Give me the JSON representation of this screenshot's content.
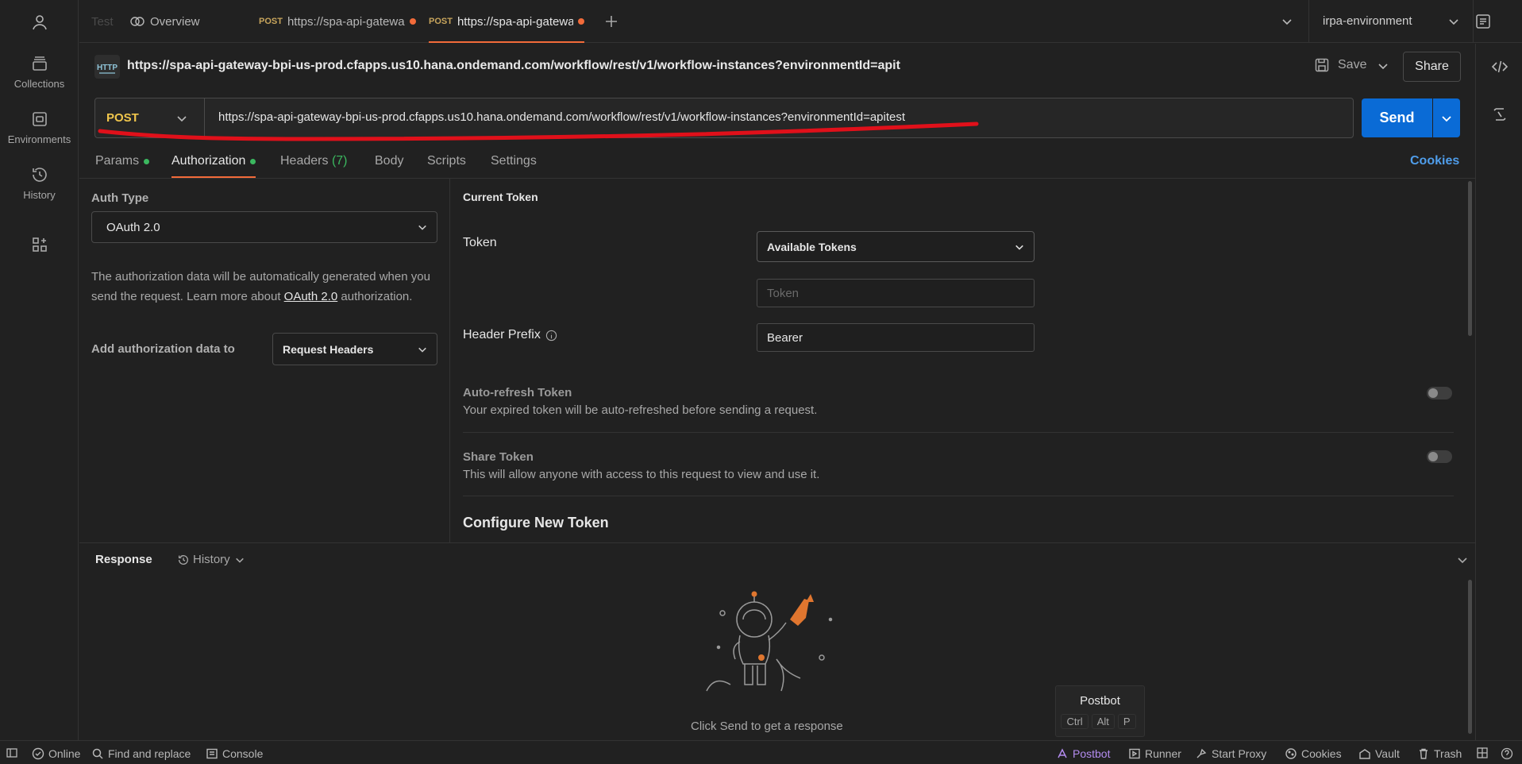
{
  "sidebar": {
    "items": [
      {
        "label": "Collections",
        "icon": "collections-icon"
      },
      {
        "label": "Environments",
        "icon": "environments-icon"
      },
      {
        "label": "History",
        "icon": "history-icon"
      }
    ]
  },
  "tabs": {
    "items": [
      {
        "label": "Test",
        "method": ""
      },
      {
        "label": "Overview",
        "method": ""
      },
      {
        "label": "https://spa-api-gatewa",
        "method": "POST",
        "unsaved": true
      },
      {
        "label": "https://spa-api-gatewa",
        "method": "POST",
        "unsaved": true,
        "active": true
      }
    ],
    "environment": "irpa-environment"
  },
  "request": {
    "title": "https://spa-api-gateway-bpi-us-prod.cfapps.us10.hana.ondemand.com/workflow/rest/v1/workflow-instances?environmentId=apit",
    "save_label": "Save",
    "share_label": "Share",
    "method": "POST",
    "url": "https://spa-api-gateway-bpi-us-prod.cfapps.us10.hana.ondemand.com/workflow/rest/v1/workflow-instances?environmentId=apitest",
    "send_label": "Send"
  },
  "request_tabs": {
    "params": "Params",
    "authorization": "Authorization",
    "headers": "Headers",
    "headers_count": "(7)",
    "body": "Body",
    "scripts": "Scripts",
    "settings": "Settings",
    "cookies": "Cookies"
  },
  "auth": {
    "type_label": "Auth Type",
    "type_value": "OAuth 2.0",
    "desc_prefix": "The authorization data will be automatically generated when you send the request. Learn more about ",
    "desc_link": "OAuth 2.0",
    "desc_suffix": " authorization.",
    "add_to_label": "Add authorization data to",
    "add_to_value": "Request Headers"
  },
  "token": {
    "section_title": "Current Token",
    "token_label": "Token",
    "available_tokens": "Available Tokens",
    "token_placeholder": "Token",
    "header_prefix_label": "Header Prefix",
    "header_prefix_value": "Bearer",
    "auto_refresh_title": "Auto-refresh Token",
    "auto_refresh_desc": "Your expired token will be auto-refreshed before sending a request.",
    "share_title": "Share Token",
    "share_desc": "This will allow anyone with access to this request to view and use it.",
    "configure_title": "Configure New Token"
  },
  "response": {
    "label": "Response",
    "history_label": "History",
    "empty_text": "Click Send to get a response"
  },
  "postbot": {
    "title": "Postbot",
    "keys": [
      "Ctrl",
      "Alt",
      "P"
    ]
  },
  "statusbar": {
    "online": "Online",
    "find_replace": "Find and replace",
    "console": "Console",
    "postbot": "Postbot",
    "runner": "Runner",
    "start_proxy": "Start Proxy",
    "cookies": "Cookies",
    "vault": "Vault",
    "trash": "Trash"
  },
  "colors": {
    "accent": "#f26b3a",
    "send": "#0a6bd6",
    "method_post": "#f0c64c",
    "annotation": "#e0101a"
  }
}
